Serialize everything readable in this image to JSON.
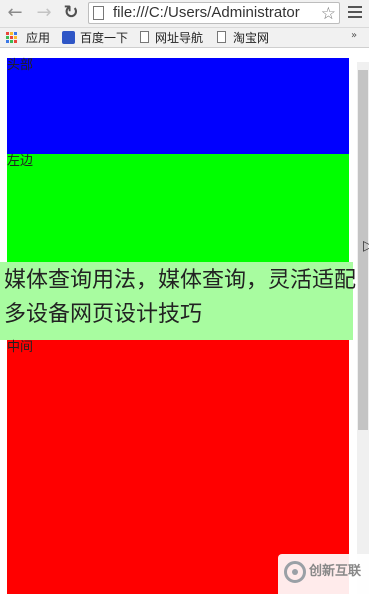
{
  "browser": {
    "url": "file:///C:/Users/Administrator",
    "bookmarks": [
      {
        "label": "应用",
        "icon": "apps-grid-icon"
      },
      {
        "label": "百度一下",
        "icon": "baidu-paw-icon"
      },
      {
        "label": "网址导航",
        "icon": "page-icon"
      },
      {
        "label": "淘宝网",
        "icon": "page-icon"
      }
    ],
    "more_symbol": "»"
  },
  "page": {
    "blocks": [
      {
        "label": "头部",
        "color": "#0000ff"
      },
      {
        "label": "左边",
        "color": "#00ff00"
      },
      {
        "label": "中间",
        "color": "#ff0000"
      }
    ],
    "overlay_title": "媒体查询用法，媒体查询，灵活适配多设备网页设计技巧"
  },
  "watermark": {
    "text": "创新互联"
  }
}
